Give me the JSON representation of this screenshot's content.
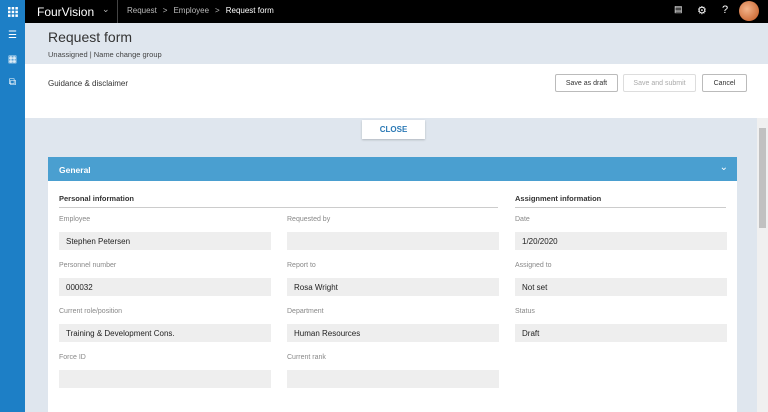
{
  "app": {
    "brand": "FourVision",
    "breadcrumbs": [
      "Request",
      "Employee",
      "Request form"
    ]
  },
  "page": {
    "title": "Request form",
    "subtitle": "Unassigned | Name change group",
    "guidance": "Guidance & disclaimer"
  },
  "actions": {
    "save_draft": "Save as draft",
    "save_submit": "Save and submit",
    "cancel": "Cancel",
    "close": "CLOSE"
  },
  "panel": {
    "title": "General",
    "personal_title": "Personal information",
    "assignment_title": "Assignment information",
    "fields": [
      {
        "label": "Employee",
        "value": "Stephen Petersen"
      },
      {
        "label": "Requested by",
        "value": ""
      },
      {
        "label": "Date",
        "value": "1/20/2020"
      },
      {
        "label": "Personnel number",
        "value": "000032"
      },
      {
        "label": "Report to",
        "value": "Rosa Wright"
      },
      {
        "label": "Assigned to",
        "value": "Not set"
      },
      {
        "label": "Current role/position",
        "value": "Training & Development Cons."
      },
      {
        "label": "Department",
        "value": "Human Resources"
      },
      {
        "label": "Status",
        "value": "Draft"
      },
      {
        "label": "Force ID",
        "value": ""
      },
      {
        "label": "Current rank",
        "value": ""
      }
    ]
  }
}
